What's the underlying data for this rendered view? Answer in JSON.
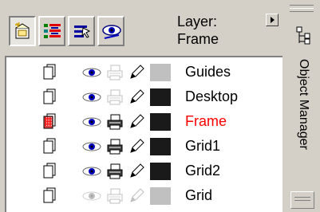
{
  "panel": {
    "layer_label_line1": "Layer:",
    "layer_label_line2": "Frame",
    "side_tab_label": "Object Manager"
  },
  "toolbar": {
    "buttons": [
      {
        "icon": "new-layer-icon"
      },
      {
        "icon": "layer-list-icon"
      },
      {
        "icon": "layer-manager-view-icon"
      },
      {
        "icon": "edit-across-layers-icon"
      }
    ]
  },
  "layers": [
    {
      "name": "Guides",
      "visible": true,
      "printable": false,
      "editable": true,
      "color": "#c0c0c0",
      "name_color": "#000000",
      "active": false
    },
    {
      "name": "Desktop",
      "visible": true,
      "printable": false,
      "editable": true,
      "color": "#1a1a1a",
      "name_color": "#000000",
      "active": false
    },
    {
      "name": "Frame",
      "visible": true,
      "printable": true,
      "editable": true,
      "color": "#1a1a1a",
      "name_color": "#ff0000",
      "active": true
    },
    {
      "name": "Grid1",
      "visible": true,
      "printable": true,
      "editable": true,
      "color": "#1a1a1a",
      "name_color": "#000000",
      "active": false
    },
    {
      "name": "Grid2",
      "visible": true,
      "printable": true,
      "editable": true,
      "color": "#1a1a1a",
      "name_color": "#000000",
      "active": false
    },
    {
      "name": "Grid",
      "visible": false,
      "printable": false,
      "editable": false,
      "color": "#c0c0c0",
      "name_color": "#000000",
      "active": false
    }
  ]
}
